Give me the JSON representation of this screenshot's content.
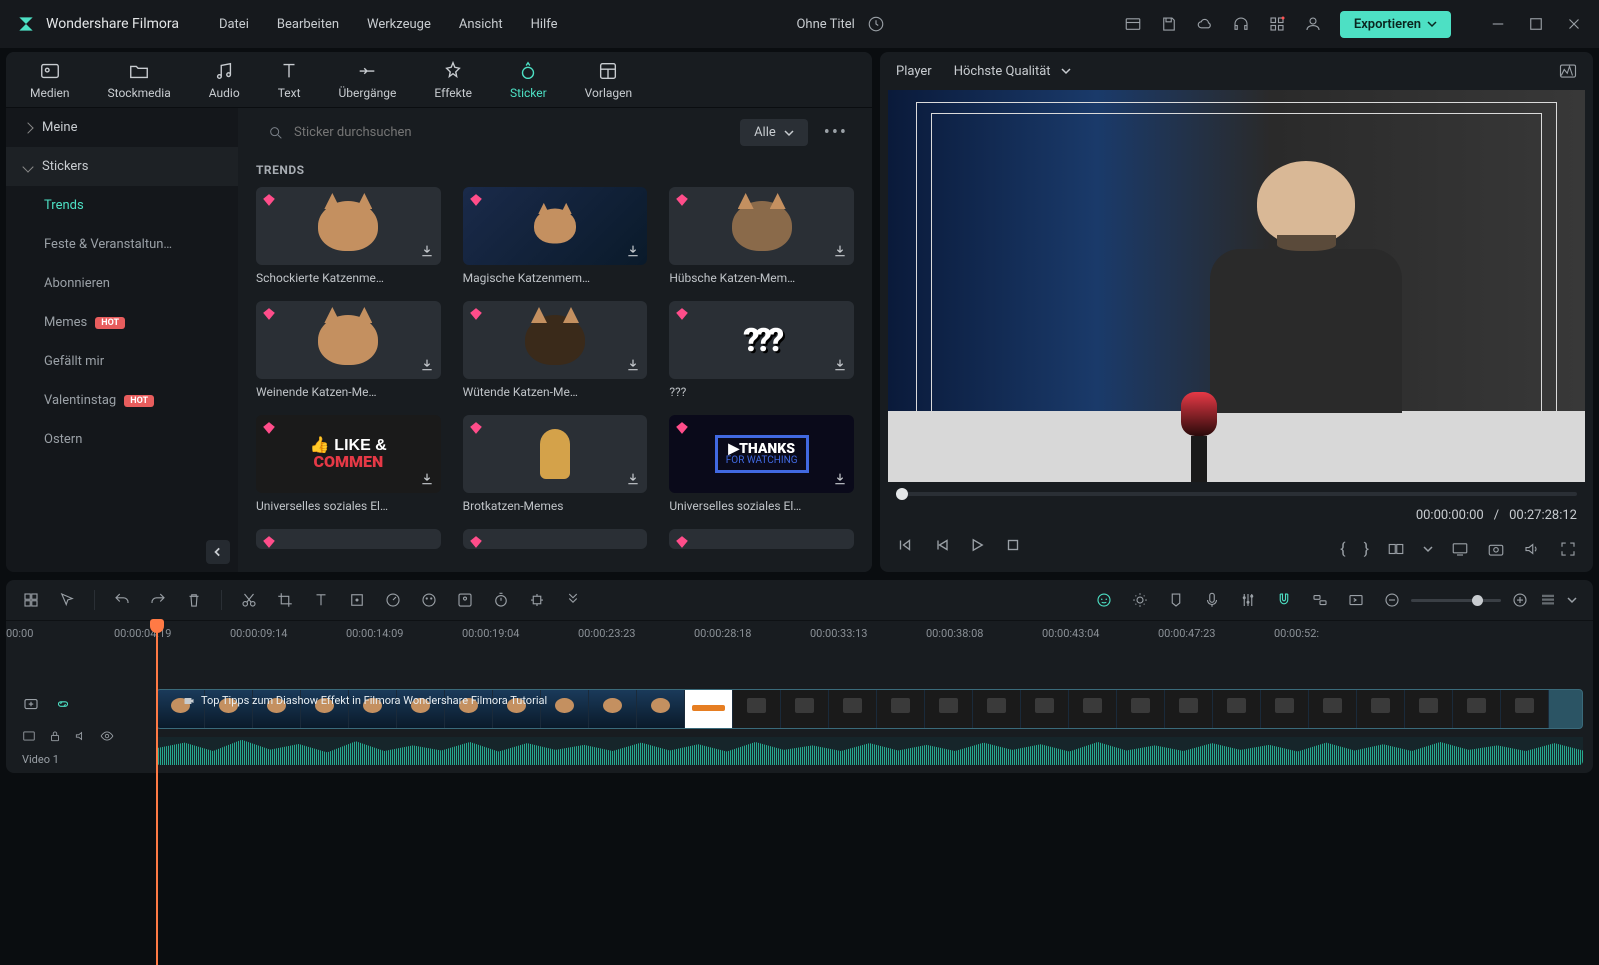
{
  "app": {
    "name": "Wondershare Filmora"
  },
  "menu": [
    "Datei",
    "Bearbeiten",
    "Werkzeuge",
    "Ansicht",
    "Hilfe"
  ],
  "project": {
    "title": "Ohne Titel"
  },
  "export_label": "Exportieren",
  "main_tabs": [
    {
      "id": "medien",
      "label": "Medien"
    },
    {
      "id": "stockmedia",
      "label": "Stockmedia"
    },
    {
      "id": "audio",
      "label": "Audio"
    },
    {
      "id": "text",
      "label": "Text"
    },
    {
      "id": "uebergaenge",
      "label": "Übergänge"
    },
    {
      "id": "effekte",
      "label": "Effekte"
    },
    {
      "id": "sticker",
      "label": "Sticker",
      "active": true
    },
    {
      "id": "vorlagen",
      "label": "Vorlagen"
    }
  ],
  "sidebar": {
    "groups": [
      {
        "label": "Meine",
        "expanded": false
      },
      {
        "label": "Stickers",
        "expanded": true
      }
    ],
    "items": [
      {
        "label": "Trends",
        "active": true
      },
      {
        "label": "Feste & Veranstaltun…"
      },
      {
        "label": "Abonnieren"
      },
      {
        "label": "Memes",
        "badge": "HOT"
      },
      {
        "label": "Gefällt mir"
      },
      {
        "label": "Valentinstag",
        "badge": "HOT"
      },
      {
        "label": "Ostern"
      }
    ]
  },
  "search": {
    "placeholder": "Sticker durchsuchen"
  },
  "filter": {
    "label": "Alle"
  },
  "section_title": "TRENDS",
  "grid_items": [
    {
      "label": "Schockierte Katzenme…",
      "kind": "cat"
    },
    {
      "label": "Magische Katzenmem…",
      "kind": "cat-magic"
    },
    {
      "label": "Hübsche Katzen-Mem…",
      "kind": "cat"
    },
    {
      "label": "Weinende Katzen-Me…",
      "kind": "cat"
    },
    {
      "label": "Wütende Katzen-Me…",
      "kind": "cat"
    },
    {
      "label": "???",
      "kind": "qmarks"
    },
    {
      "label": "Universelles soziales El…",
      "kind": "like"
    },
    {
      "label": "Brotkatzen-Memes",
      "kind": "bread"
    },
    {
      "label": "Universelles soziales El…",
      "kind": "thanks"
    }
  ],
  "player": {
    "tab": "Player",
    "quality": "Höchste Qualität",
    "current_time": "00:00:00:00",
    "separator": "/",
    "total_time": "00:27:28:12"
  },
  "timeline": {
    "ruler": [
      "00:00",
      "00:00:04:19",
      "00:00:09:14",
      "00:00:14:09",
      "00:00:19:04",
      "00:00:23:23",
      "00:00:28:18",
      "00:00:33:13",
      "00:00:38:08",
      "00:00:43:04",
      "00:00:47:23",
      "00:00:52:"
    ],
    "track_label": "Video 1",
    "clip_title": "Top Tipps zum Diashow Effekt in Filmora  Wondershare Filmora Tutorial"
  }
}
